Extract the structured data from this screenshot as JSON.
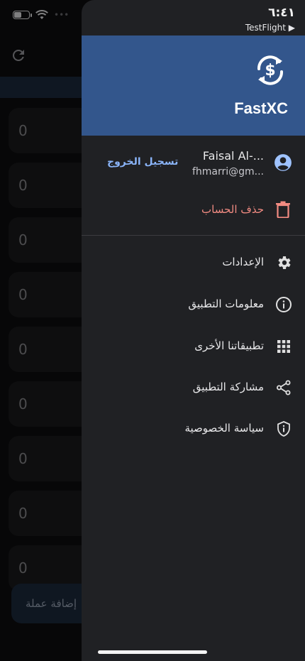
{
  "background": {
    "row_values": [
      "0",
      "0",
      "0",
      "0",
      "0",
      "0",
      "0",
      "0",
      "0"
    ],
    "add_button_label": "إضافة عملة"
  },
  "status": {
    "time": "٦:٤١",
    "back_app": "TestFlight ▶"
  },
  "drawer": {
    "app_name": "FastXC",
    "account": {
      "name": "Faisal Al-...",
      "email": "fhmarri@gm...",
      "logout_label": "تسجيل الخروج"
    },
    "delete_account_label": "حذف الحساب",
    "menu": [
      {
        "label": "الإعدادات",
        "icon": "gear-icon"
      },
      {
        "label": "معلومات التطبيق",
        "icon": "info-icon"
      },
      {
        "label": "تطبيقاتنا الأخرى",
        "icon": "apps-grid-icon"
      },
      {
        "label": "مشاركة التطبيق",
        "icon": "share-icon"
      },
      {
        "label": "سياسة الخصوصية",
        "icon": "shield-icon"
      }
    ]
  },
  "colors": {
    "header": "#33568c",
    "drawer_bg": "#202124",
    "logout": "#8ab4f8",
    "delete": "#f28b82"
  }
}
